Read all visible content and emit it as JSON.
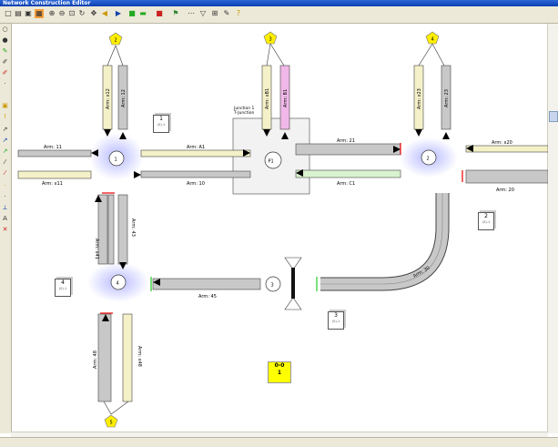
{
  "window": {
    "title": "Network Construction Editor"
  },
  "toolbar": {
    "icons": [
      "new-icon",
      "open-icon",
      "save-icon",
      "print-icon",
      "zoom-in-icon",
      "zoom-out-icon",
      "zoom-fit-icon",
      "refresh-icon",
      "pan-icon",
      "select-icon",
      "arrow-left-icon",
      "arrow-right-icon",
      "color-green-icon",
      "color-red-icon",
      "flag-icon",
      "line-icon",
      "filter-icon",
      "grid-icon",
      "tool-icon",
      "help-icon"
    ]
  },
  "arms": {
    "a11": "Arm: 11",
    "ax11": "Arm: x11",
    "a12": "Arm: 12",
    "ax12": "Arm: x12",
    "aA1": "Arm: A1",
    "a10": "Arm: 10",
    "a21": "Arm: 21",
    "aC1": "Arm: C1",
    "ax20": "Arm: x20",
    "a20": "Arm: 20",
    "a23": "Arm: 23",
    "ax23": "Arm: x23",
    "aB1": "Arm: B1",
    "axB1": "Arm: xB1",
    "ax41": "Arm: x41",
    "a43": "Arm: 43",
    "a45": "Arm: 45",
    "a30": "Arm: 30",
    "a48": "Arm: 48",
    "ax48": "Arm: x48"
  },
  "nodes": {
    "n1": "1",
    "n2": "2",
    "n3": "3",
    "n4": "4",
    "p1": "P1"
  },
  "pentagons": {
    "top1": "2",
    "top2": "3",
    "top3": "4",
    "bottom": "5"
  },
  "junction": {
    "title1": "Junction 1",
    "title2": "T-Junction"
  },
  "zones": [
    {
      "num": "1",
      "sub": "(0)-1"
    },
    {
      "num": "2",
      "sub": "(0)-1"
    },
    {
      "num": "3",
      "sub": "(0)-1"
    },
    {
      "num": "4",
      "sub": "(0)-1"
    }
  ],
  "clock": {
    "line1": "0-0",
    "line2": "1"
  },
  "colors": {
    "lane_grey": "#c8c8c8",
    "lane_yellow": "#f4f1c8",
    "lane_green": "#d9f2cf",
    "lane_pink": "#f0b8e8",
    "pentagon": "#ffee00",
    "accent": "#7a80ff"
  }
}
